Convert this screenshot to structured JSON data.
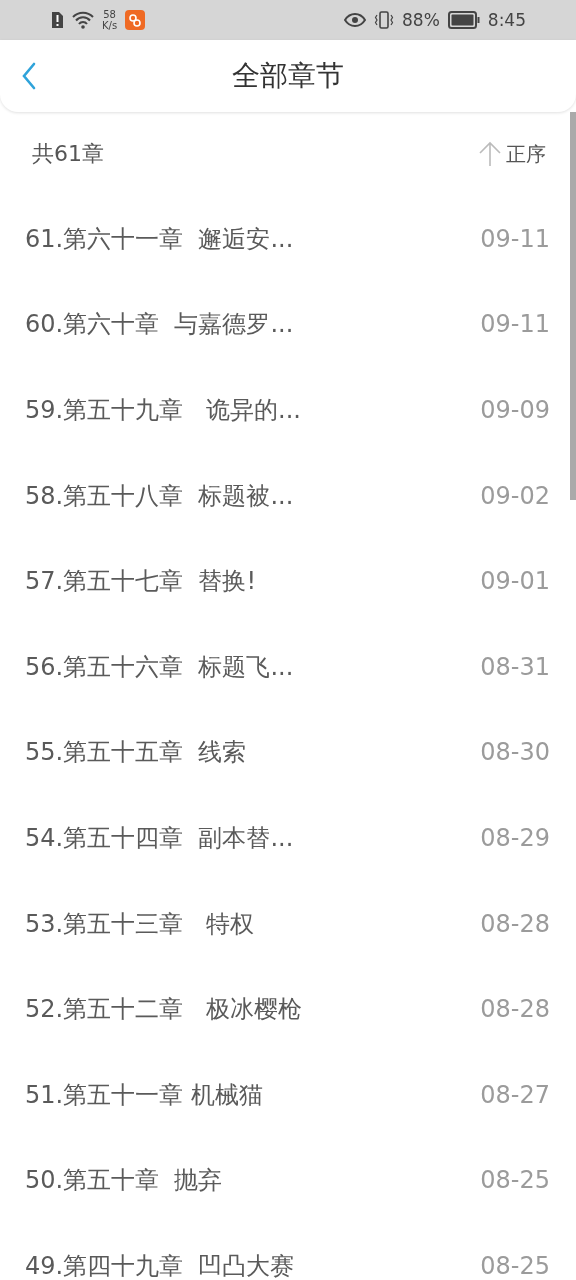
{
  "status_bar": {
    "speed_value": "58",
    "speed_unit": "K/s",
    "battery": "88%",
    "time": "8:45"
  },
  "header": {
    "title": "全部章节"
  },
  "summary": {
    "count": "共61章",
    "sort": "正序"
  },
  "chapters": [
    {
      "title": "61.第六十一章  邂逅安...",
      "date": "09-11"
    },
    {
      "title": "60.第六十章  与嘉德罗...",
      "date": "09-11"
    },
    {
      "title": "59.第五十九章   诡异的...",
      "date": "09-09"
    },
    {
      "title": "58.第五十八章  标题被...",
      "date": "09-02"
    },
    {
      "title": "57.第五十七章  替换!",
      "date": "09-01"
    },
    {
      "title": "56.第五十六章  标题飞...",
      "date": "08-31"
    },
    {
      "title": "55.第五十五章  线索",
      "date": "08-30"
    },
    {
      "title": "54.第五十四章  副本替...",
      "date": "08-29"
    },
    {
      "title": "53.第五十三章   特权",
      "date": "08-28"
    },
    {
      "title": "52.第五十二章   极冰樱枪",
      "date": "08-28"
    },
    {
      "title": "51.第五十一章 机械猫",
      "date": "08-27"
    },
    {
      "title": "50.第五十章  抛弃",
      "date": "08-25"
    },
    {
      "title": "49.第四十九章  凹凸大赛",
      "date": "08-25"
    }
  ]
}
